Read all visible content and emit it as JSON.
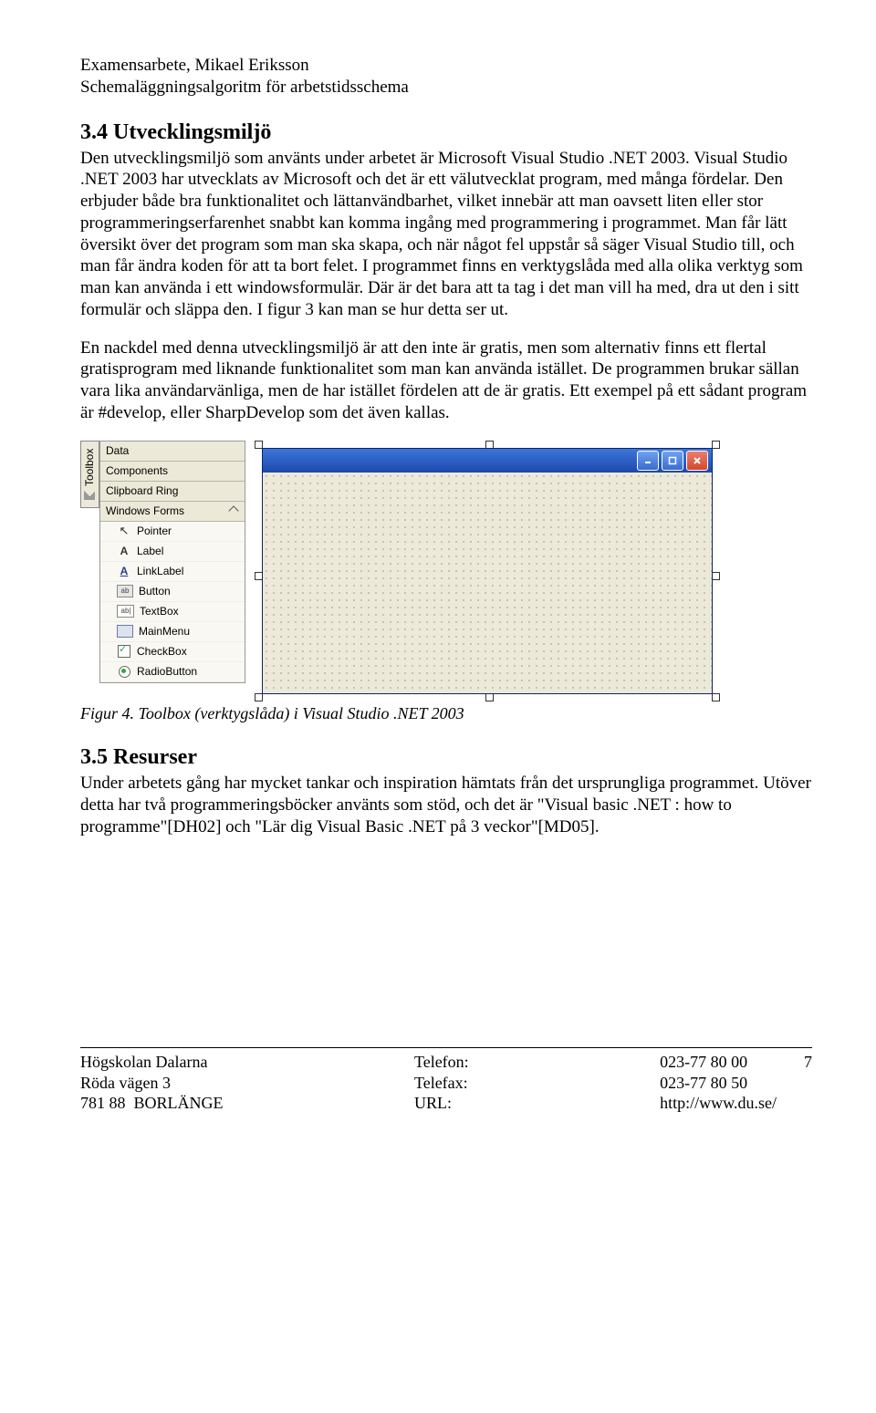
{
  "header": {
    "line1": "Examensarbete, Mikael Eriksson",
    "line2": "Schemaläggningsalgoritm för arbetstidsschema"
  },
  "section34": {
    "title": "3.4 Utvecklingsmiljö",
    "para1": "Den utvecklingsmiljö som använts under arbetet är Microsoft Visual Studio .NET 2003. Visual Studio .NET 2003 har utvecklats av Microsoft och det är ett välutvecklat program, med många fördelar. Den erbjuder både bra funktionalitet och lättanvändbarhet, vilket innebär att man oavsett liten eller stor programmeringserfarenhet snabbt kan komma ingång med programmering i programmet. Man får lätt översikt över det program som man ska skapa, och när något fel uppstår så säger Visual Studio till, och man får ändra koden för att ta bort felet. I programmet finns en verktygslåda med alla olika verktyg som man kan använda i ett windowsformulär. Där är det bara att ta tag i det man vill ha med, dra ut den i sitt formulär och släppa den. I figur 3 kan man se hur detta ser ut.",
    "para2": "En nackdel med denna utvecklingsmiljö är att den inte är gratis, men som alternativ finns ett flertal gratisprogram med liknande funktionalitet som man kan använda istället. De programmen brukar sällan vara lika användarvänliga, men de har istället fördelen att de är gratis. Ett exempel på ett sådant program är #develop, eller SharpDevelop som det även kallas."
  },
  "toolbox": {
    "tab": "Toolbox",
    "sections": [
      "Data",
      "Components",
      "Clipboard Ring",
      "Windows Forms"
    ],
    "items": [
      {
        "icon": "pointer",
        "label": "Pointer"
      },
      {
        "icon": "label",
        "label": "Label"
      },
      {
        "icon": "linklabel",
        "label": "LinkLabel"
      },
      {
        "icon": "button",
        "label": "Button"
      },
      {
        "icon": "textbox",
        "label": "TextBox"
      },
      {
        "icon": "mainmenu",
        "label": "MainMenu"
      },
      {
        "icon": "checkbox",
        "label": "CheckBox"
      },
      {
        "icon": "radio",
        "label": "RadioButton"
      }
    ]
  },
  "figure_caption": "Figur 4. Toolbox (verktygslåda) i Visual Studio .NET 2003",
  "section35": {
    "title": "3.5 Resurser",
    "para": "Under arbetets gång har mycket tankar och inspiration hämtats från det ursprungliga programmet. Utöver detta har två programmeringsböcker använts som stöd, och det är \"Visual basic .NET : how to programme\"[DH02] och \"Lär dig Visual Basic .NET på 3 veckor\"[MD05]."
  },
  "footer": {
    "left": "Högskolan Dalarna\nRöda vägen 3\n781 88  BORLÄNGE",
    "mid": "Telefon:\nTelefax:\nURL:",
    "right": "023-77 80 00\n023-77 80 50\nhttp://www.du.se/",
    "page": "7"
  }
}
